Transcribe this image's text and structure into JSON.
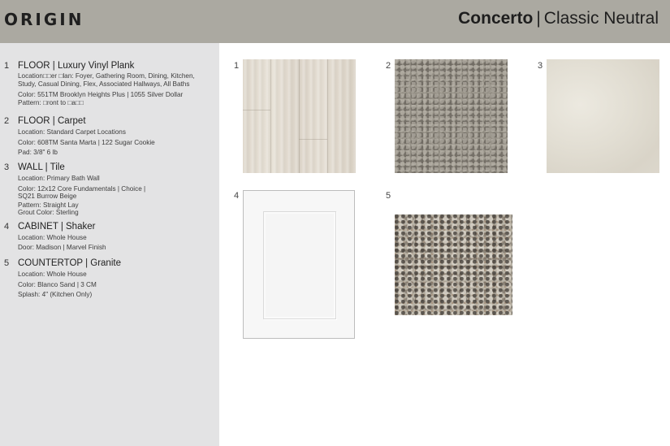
{
  "header": {
    "logo": "ORIGIN",
    "title_bold": "Concerto",
    "title_sep": "|",
    "title_rest": "Classic Neutral"
  },
  "selections": [
    {
      "number": "1",
      "heading": "FLOOR | Luxury Vinyl Plank",
      "lines": [
        "Location□□er □lan: Foyer, Gathering Room, Dining, Kitchen,",
        "Study, Casual Dining, Flex, Associated Hallways,  All Baths",
        "Color: 551TM Brooklyn Heights Plus | 1055 Silver Dollar",
        "Pattern: □ront to □a□□"
      ]
    },
    {
      "number": "2",
      "heading": "FLOOR | Carpet",
      "lines": [
        "Location: Standard Carpet Locations",
        "Color: 608TM Santa Marta | 122 Sugar Cookie",
        "Pad: 3/8\" 6 lb"
      ]
    },
    {
      "number": "3",
      "heading": "WALL | Tile",
      "lines": [
        "Location: Primary Bath Wall",
        "Color: 12x12 Core Fundamentals | Choice |",
        "SQ21 Burrow Beige",
        "Pattern: Straight Lay",
        "Grout Color: Sterling"
      ]
    },
    {
      "number": "4",
      "heading": "CABINET | Shaker",
      "lines": [
        "Location: Whole House",
        "Door: Madison | Marvel Finish"
      ]
    },
    {
      "number": "5",
      "heading": "COUNTERTOP | Granite",
      "lines": [
        "Location: Whole House",
        "Color: Blanco Sand | 3 CM",
        "Splash: 4\" (Kitchen Only)"
      ]
    }
  ],
  "swatches": [
    {
      "number": "1",
      "material": "luxury-vinyl-plank"
    },
    {
      "number": "2",
      "material": "carpet"
    },
    {
      "number": "3",
      "material": "wall-tile"
    },
    {
      "number": "4",
      "material": "cabinet-door"
    },
    {
      "number": "5",
      "material": "granite"
    }
  ]
}
